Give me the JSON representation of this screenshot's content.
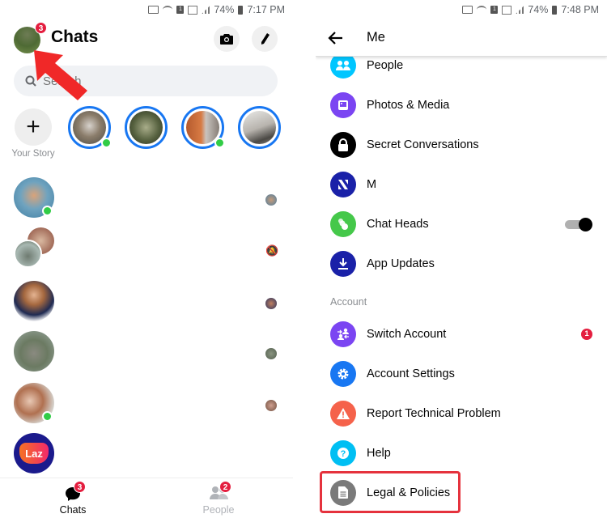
{
  "left": {
    "statusbar": {
      "battery": "74%",
      "time": "7:17 PM"
    },
    "header": {
      "title": "Chats",
      "profile_badge": "3"
    },
    "search": {
      "placeholder": "Search"
    },
    "stories": {
      "add_label": "Your Story"
    },
    "chats": [
      {
        "online": true,
        "seen": true
      },
      {
        "online": false,
        "muted": true
      },
      {
        "online": false,
        "seen": true
      },
      {
        "online": false,
        "seen": true
      },
      {
        "online": true,
        "seen": true
      },
      {
        "avatar_text": "Laz"
      }
    ],
    "bottom_nav": [
      {
        "label": "Chats",
        "badge": "3",
        "active": true
      },
      {
        "label": "People",
        "badge": "2",
        "active": false
      }
    ]
  },
  "right": {
    "statusbar": {
      "battery": "74%",
      "time": "7:48 PM"
    },
    "header": {
      "title": "Me"
    },
    "items": [
      {
        "label": "People",
        "icon": "people-icon",
        "color": "#00c6ff"
      },
      {
        "label": "Photos & Media",
        "icon": "photo-icon",
        "color": "#7b45f2"
      },
      {
        "label": "Secret Conversations",
        "icon": "lock-icon",
        "color": "#000000"
      },
      {
        "label": "M",
        "icon": "m-assistant-icon",
        "color": "#1a21a8"
      },
      {
        "label": "Chat Heads",
        "icon": "chat-heads-icon",
        "color": "#45c84a",
        "toggle": true
      },
      {
        "label": "App Updates",
        "icon": "download-icon",
        "color": "#1a21a8"
      }
    ],
    "account_section": {
      "label": "Account",
      "items": [
        {
          "label": "Switch Account",
          "icon": "switch-account-icon",
          "color": "#7b45f2",
          "badge": "1"
        },
        {
          "label": "Account Settings",
          "icon": "gear-icon",
          "color": "#1877f2"
        },
        {
          "label": "Report Technical Problem",
          "icon": "warning-icon",
          "color": "#f5624b"
        },
        {
          "label": "Help",
          "icon": "help-icon",
          "color": "#00bff3"
        },
        {
          "label": "Legal & Policies",
          "icon": "document-icon",
          "color": "#7a7a7a"
        }
      ]
    }
  },
  "colors": {
    "accent": "#1877f2",
    "badge": "#e41e3f",
    "online": "#31cc46",
    "highlight": "#e5323d"
  }
}
